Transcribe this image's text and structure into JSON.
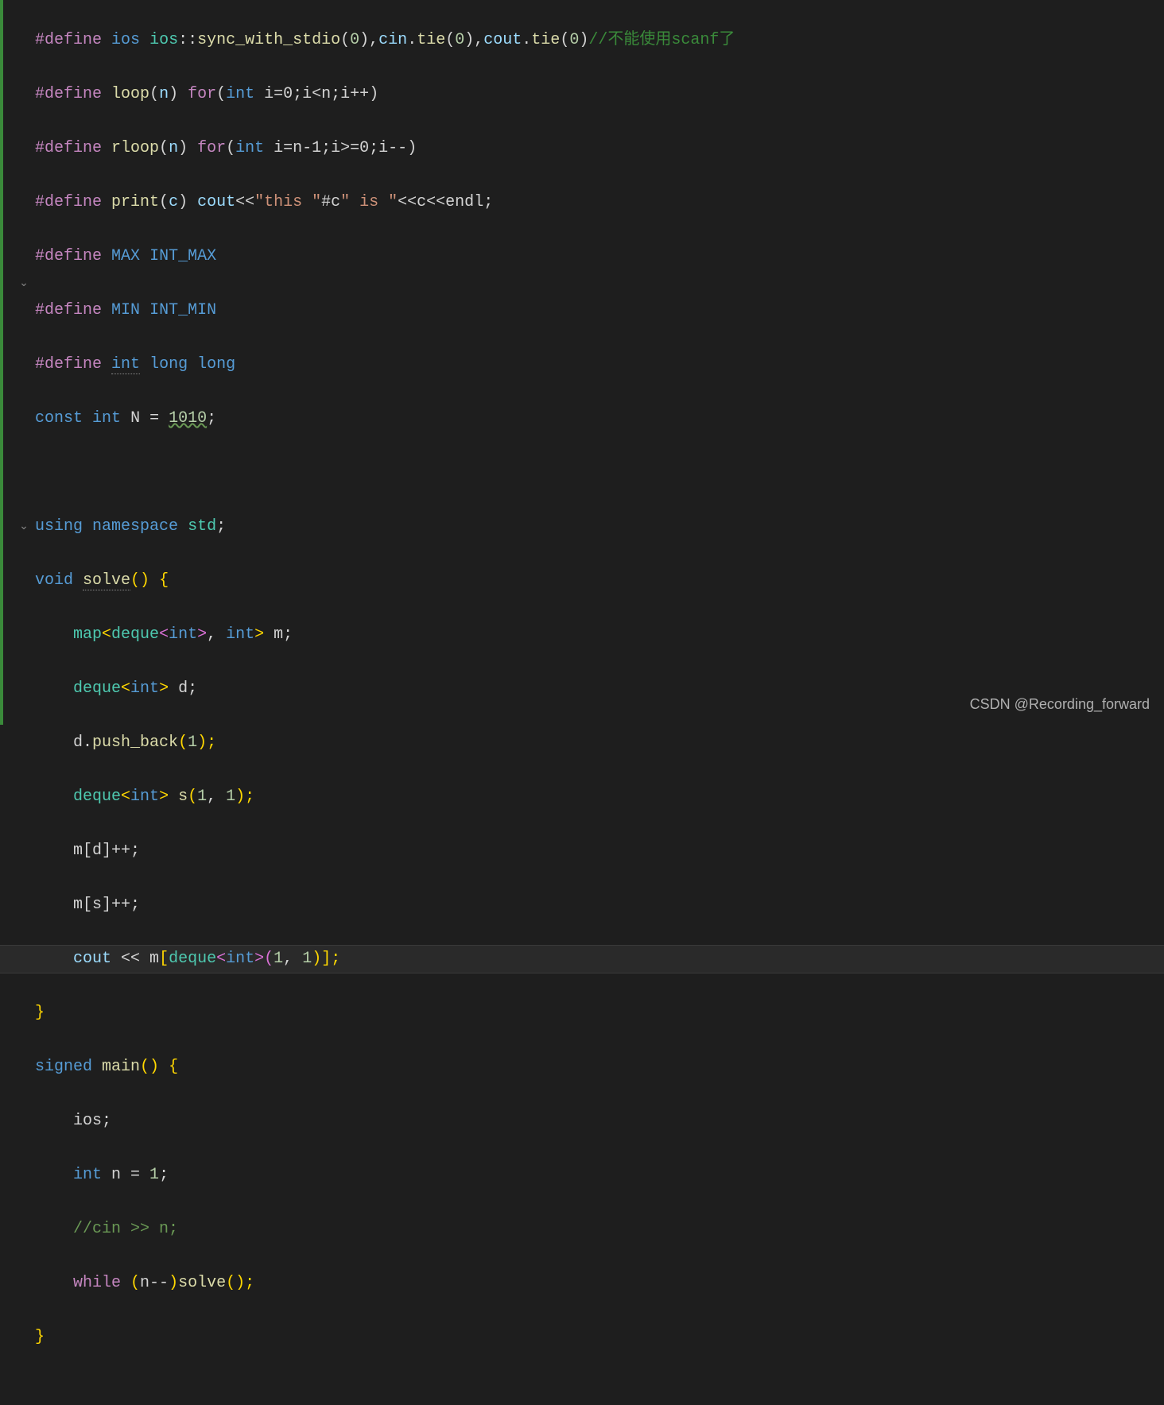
{
  "watermark": "CSDN @Recording_forward",
  "code": {
    "line1": {
      "define": "#define",
      "ios1": "ios",
      "ios2": "ios",
      "sync": "sync_with_stdio",
      "zero1": "0",
      "cin": "cin",
      "tie1": "tie",
      "zero2": "0",
      "cout": "cout",
      "tie2": "tie",
      "zero3": "0",
      "comment": "//不能使用scanf了"
    },
    "line2": {
      "define": "#define",
      "loop": "loop",
      "n": "n",
      "for": "for",
      "int": "int",
      "expr": "i=0;i<n;i++"
    },
    "line3": {
      "define": "#define",
      "rloop": "rloop",
      "n": "n",
      "for": "for",
      "int": "int",
      "expr": "i=n-1;i>=0;i--"
    },
    "line4": {
      "define": "#define",
      "print": "print",
      "c": "c",
      "cout": "cout",
      "str1": "\"this \"",
      "hashc": "#c",
      "str2": "\" is \"",
      "endl": "<<c<<endl;"
    },
    "line5": {
      "define": "#define",
      "max": "MAX",
      "intmax": "INT_MAX"
    },
    "line6": {
      "define": "#define",
      "min": "MIN",
      "intmin": "INT_MIN"
    },
    "line7": {
      "define": "#define",
      "int": "int",
      "longlong": "long long"
    },
    "line8": {
      "const": "const",
      "int": "int",
      "n": "N",
      "eq": " = ",
      "val": "1010",
      "semi": ";"
    },
    "line10": {
      "using": "using",
      "namespace": "namespace",
      "std": "std",
      "semi": ";"
    },
    "line11": {
      "void": "void",
      "solve": "solve",
      "parens": "()",
      "brace": " {"
    },
    "line12": {
      "map": "map",
      "lt": "<",
      "deque": "deque",
      "lt2": "<",
      "int": "int",
      "gt2": ">",
      "comma": ", ",
      "int2": "int",
      "gt": ">",
      "m": " m;"
    },
    "line13": {
      "deque": "deque",
      "lt": "<",
      "int": "int",
      "gt": ">",
      "d": " d;"
    },
    "line14": {
      "d": "d.",
      "push": "push_back",
      "paren": "(",
      "one": "1",
      "close": ");"
    },
    "line15": {
      "deque": "deque",
      "lt": "<",
      "int": "int",
      "gt": ">",
      "s": " s",
      "paren": "(",
      "one1": "1",
      "comma": ", ",
      "one2": "1",
      "close": ");"
    },
    "line16": {
      "expr": "m[d]++;"
    },
    "line17": {
      "expr": "m[s]++;"
    },
    "line18": {
      "cout": "cout",
      "ins": " << ",
      "m": "m",
      "lb": "[",
      "deque": "deque",
      "lt": "<",
      "int": "int",
      "gt": ">",
      "paren": "(",
      "one1": "1",
      "comma": ", ",
      "one2": "1",
      "close": ")];"
    },
    "line19": {
      "brace": "}"
    },
    "line20": {
      "signed": "signed",
      "main": "main",
      "parens": "()",
      "brace": " {"
    },
    "line21": {
      "ios": "ios;"
    },
    "line22": {
      "int": "int",
      "rest": " n = ",
      "one": "1",
      "semi": ";"
    },
    "line23": {
      "comment": "//cin >> n;"
    },
    "line24": {
      "while": "while",
      "paren": " (",
      "expr": "n--",
      "close": ")",
      "solve": "solve",
      "parens": "();"
    },
    "line25": {
      "brace": "}"
    }
  },
  "fold": {
    "down1": "⌄",
    "down2": "⌄"
  }
}
